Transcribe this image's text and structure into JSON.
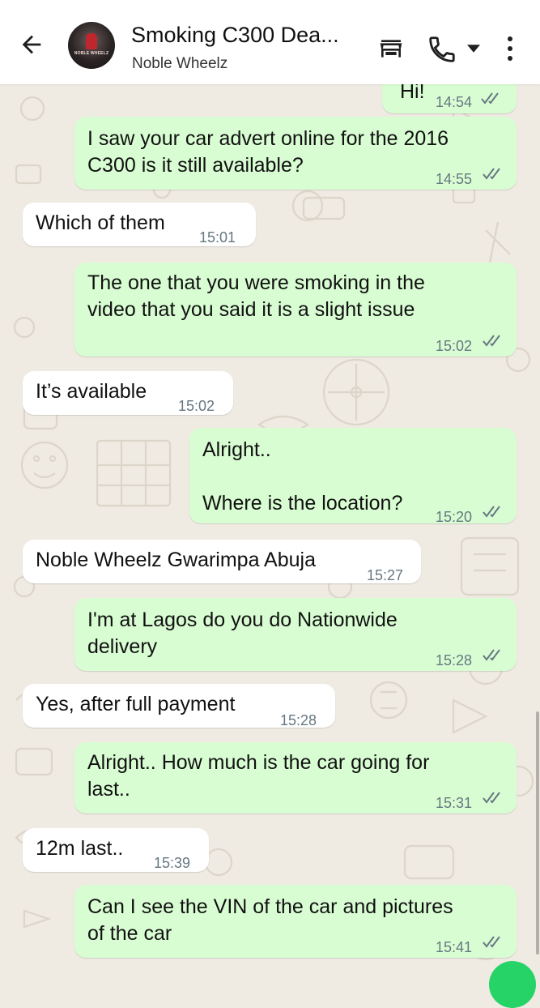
{
  "header": {
    "title": "Smoking C300 Dea...",
    "subtitle": "Noble Wheelz",
    "avatar_text": "NOBLE WHEELZ"
  },
  "messages": [
    {
      "dir": "out",
      "lines": [
        "Hi!"
      ],
      "time": "14:54",
      "status": "read"
    },
    {
      "dir": "out",
      "lines": [
        "I saw your car advert online for the 2016",
        "C300 is it still available?"
      ],
      "time": "14:55",
      "status": "read"
    },
    {
      "dir": "in",
      "lines": [
        "Which of them"
      ],
      "time": "15:01"
    },
    {
      "dir": "out",
      "lines": [
        "The one that you were smoking in the",
        "video that you said it is a slight issue"
      ],
      "time": "15:02",
      "status": "read"
    },
    {
      "dir": "in",
      "lines": [
        "It’s available"
      ],
      "time": "15:02"
    },
    {
      "dir": "out",
      "lines": [
        "Alright..",
        "",
        "Where is the location?"
      ],
      "time": "15:20",
      "status": "read"
    },
    {
      "dir": "in",
      "lines": [
        "Noble Wheelz Gwarimpa Abuja"
      ],
      "time": "15:27"
    },
    {
      "dir": "out",
      "lines": [
        "I'm at Lagos do you do Nationwide",
        "delivery"
      ],
      "time": "15:28",
      "status": "read"
    },
    {
      "dir": "in",
      "lines": [
        "Yes, after full payment"
      ],
      "time": "15:28"
    },
    {
      "dir": "out",
      "lines": [
        "Alright.. How much is the car going for",
        "last.."
      ],
      "time": "15:31",
      "status": "read"
    },
    {
      "dir": "in",
      "lines": [
        "12m last.."
      ],
      "time": "15:39"
    },
    {
      "dir": "out",
      "lines": [
        "Can I see the VIN of the car and pictures",
        "of the car"
      ],
      "time": "15:41",
      "status": "read"
    }
  ],
  "icons": {
    "back": "arrow-left-icon",
    "store": "storefront-icon",
    "call": "phone-icon",
    "call_menu": "caret-down-icon",
    "more": "more-vertical-icon",
    "read": "double-check-icon"
  },
  "colors": {
    "outgoing_bubble": "#d9fdd3",
    "incoming_bubble": "#ffffff",
    "chat_background": "#efeae2",
    "timestamp": "#667781",
    "accent": "#25d366"
  }
}
